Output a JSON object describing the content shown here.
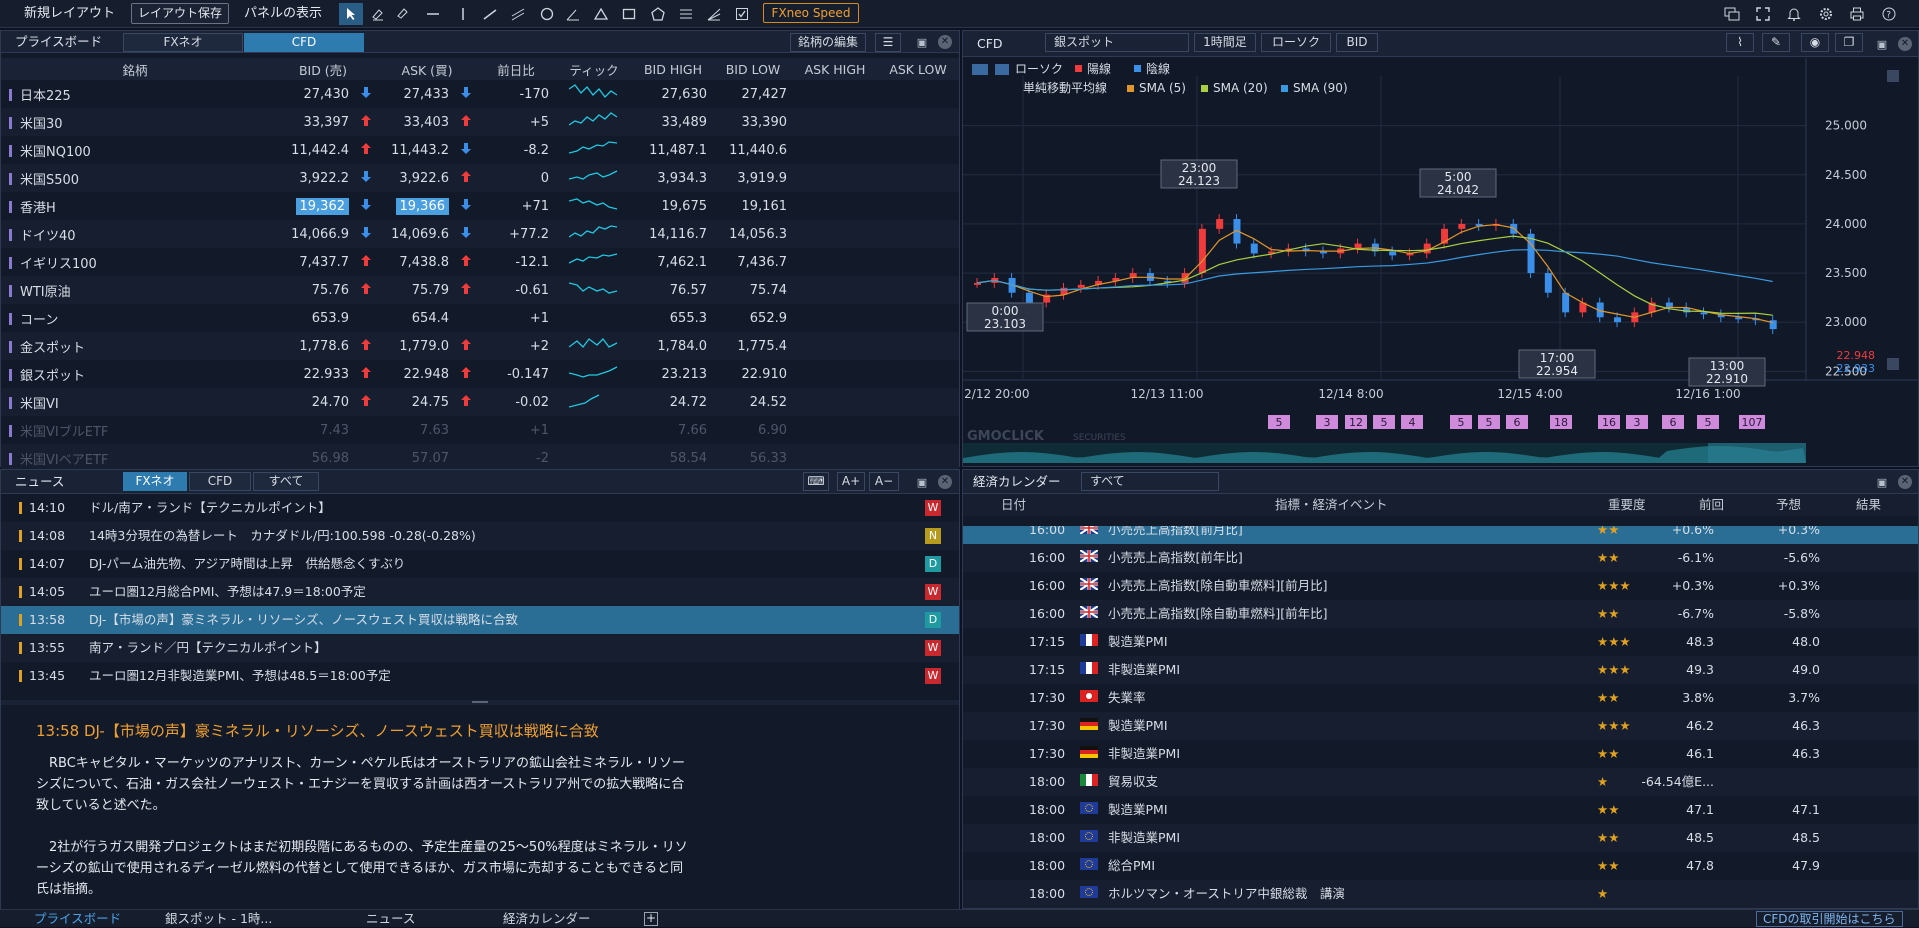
{
  "toolbar": {
    "new_layout": "新規レイアウト",
    "save_layout": "レイアウト保存",
    "panel_show": "パネルの表示",
    "speed": "FXneo Speed"
  },
  "priceboard": {
    "title": "プライスボード",
    "tabs": [
      "FXネオ",
      "CFD"
    ],
    "edit": "銘柄の編集",
    "headers": [
      "銘柄",
      "BID (売)",
      "ASK (買)",
      "前日比",
      "ティック",
      "BID HIGH",
      "BID LOW",
      "ASK HIGH",
      "ASK LOW"
    ],
    "rows": [
      {
        "name": "日本225",
        "bid": "27,430",
        "bdir": "dn",
        "ask": "27,433",
        "adir": "dn",
        "chg": "-170",
        "bh": "27,630",
        "bl": "27,427"
      },
      {
        "name": "米国30",
        "bid": "33,397",
        "bdir": "up",
        "ask": "33,403",
        "adir": "up",
        "chg": "+5",
        "bh": "33,489",
        "bl": "33,390"
      },
      {
        "name": "米国NQ100",
        "bid": "11,442.4",
        "bdir": "up",
        "ask": "11,443.2",
        "adir": "dn",
        "chg": "-8.2",
        "bh": "11,487.1",
        "bl": "11,440.6"
      },
      {
        "name": "米国S500",
        "bid": "3,922.2",
        "bdir": "dn",
        "ask": "3,922.6",
        "adir": "up",
        "chg": "0",
        "bh": "3,934.3",
        "bl": "3,919.9"
      },
      {
        "name": "香港H",
        "bid": "19,362",
        "bdir": "dn",
        "ask": "19,366",
        "adir": "dn",
        "chg": "+71",
        "bh": "19,675",
        "bl": "19,161",
        "hl": true
      },
      {
        "name": "ドイツ40",
        "bid": "14,066.9",
        "bdir": "dn",
        "ask": "14,069.6",
        "adir": "dn",
        "chg": "+77.2",
        "bh": "14,116.7",
        "bl": "14,056.3"
      },
      {
        "name": "イギリス100",
        "bid": "7,437.7",
        "bdir": "up",
        "ask": "7,438.8",
        "adir": "up",
        "chg": "-12.1",
        "bh": "7,462.1",
        "bl": "7,436.7"
      },
      {
        "name": "WTI原油",
        "bid": "75.76",
        "bdir": "up",
        "ask": "75.79",
        "adir": "up",
        "chg": "-0.61",
        "bh": "76.57",
        "bl": "75.74"
      },
      {
        "name": "コーン",
        "bid": "653.9",
        "bdir": "",
        "ask": "654.4",
        "adir": "",
        "chg": "+1",
        "bh": "655.3",
        "bl": "652.9"
      },
      {
        "name": "金スポット",
        "bid": "1,778.6",
        "bdir": "up",
        "ask": "1,779.0",
        "adir": "up",
        "chg": "+2",
        "bh": "1,784.0",
        "bl": "1,775.4"
      },
      {
        "name": "銀スポット",
        "bid": "22.933",
        "bdir": "up",
        "ask": "22.948",
        "adir": "up",
        "chg": "-0.147",
        "bh": "23.213",
        "bl": "22.910"
      },
      {
        "name": "米国VI",
        "bid": "24.70",
        "bdir": "up",
        "ask": "24.75",
        "adir": "up",
        "chg": "-0.02",
        "bh": "24.72",
        "bl": "24.52"
      },
      {
        "name": "米国VIブルETF",
        "bid": "7.43",
        "bdir": "",
        "ask": "7.63",
        "adir": "",
        "chg": "+1",
        "bh": "7.66",
        "bl": "6.90",
        "dim": true
      },
      {
        "name": "米国VIベアETF",
        "bid": "56.98",
        "bdir": "",
        "ask": "57.07",
        "adir": "",
        "chg": "-2",
        "bh": "58.54",
        "bl": "56.33",
        "dim": true
      }
    ]
  },
  "chart": {
    "title": "CFD",
    "symbol": "銀スポット",
    "timeframe": "1時間足",
    "ctype": "ローソク",
    "price_type": "BID",
    "legend": {
      "type": "ローソク",
      "up": "陽線",
      "down": "陰線",
      "ma": "単純移動平均線",
      "sma5": "SMA (5)",
      "sma20": "SMA (20)",
      "sma90": "SMA (90)"
    },
    "yticks": [
      "25.000",
      "24.500",
      "24.000",
      "23.500",
      "23.000",
      "22.500"
    ],
    "xticks": [
      "12/12 20:00",
      "12/13 11:00",
      "12/14 8:00",
      "12/15 4:00",
      "12/16 1:00"
    ],
    "callouts": [
      {
        "time": "0:00",
        "price": "23.103"
      },
      {
        "time": "23:00",
        "price": "24.123"
      },
      {
        "time": "5:00",
        "price": "24.042"
      },
      {
        "time": "17:00",
        "price": "22.954"
      },
      {
        "time": "13:00",
        "price": "22.910"
      }
    ],
    "price_ask": "22.948",
    "price_bid": "22.933",
    "events": [
      "5",
      "3",
      "12",
      "5",
      "4",
      "5",
      "5",
      "6",
      "18",
      "16",
      "3",
      "6",
      "5",
      "107"
    ],
    "watermark": "GMOCLICK",
    "watermark2": "SECURITIES",
    "chart_data": {
      "type": "line",
      "ylim": [
        22.3,
        25.2
      ],
      "candles": [
        23.4,
        23.45,
        23.3,
        23.2,
        23.28,
        23.35,
        23.38,
        23.42,
        23.45,
        23.5,
        23.42,
        23.4,
        23.5,
        23.95,
        24.05,
        23.8,
        23.7,
        23.72,
        23.75,
        23.72,
        23.7,
        23.75,
        23.8,
        23.72,
        23.68,
        23.7,
        23.8,
        23.95,
        24.0,
        23.98,
        24.0,
        23.9,
        23.5,
        23.3,
        23.1,
        23.2,
        23.05,
        23.0,
        23.1,
        23.2,
        23.15,
        23.1,
        23.08,
        23.05,
        23.04,
        23.02,
        22.93
      ]
    }
  },
  "news": {
    "title": "ニュース",
    "tabs": [
      "FXネオ",
      "CFD",
      "すべて"
    ],
    "aplus": "A+",
    "aminus": "A−",
    "items": [
      {
        "time": "14:10",
        "head": "ドル/南ア・ランド【テクニカルポイント】",
        "src": "W"
      },
      {
        "time": "14:08",
        "head": "14時3分現在の為替レート　カナダドル/円:100.598 -0.28(-0.28%)",
        "src": "N"
      },
      {
        "time": "14:07",
        "head": "DJ-パーム油先物、アジア時間は上昇　供給懸念くすぶり",
        "src": "D"
      },
      {
        "time": "14:05",
        "head": "ユーロ圏12月総合PMI、予想は47.9＝18:00予定",
        "src": "W"
      },
      {
        "time": "13:58",
        "head": "DJ-【市場の声】豪ミネラル・リソーシズ、ノースウェスト買収は戦略に合致",
        "src": "D",
        "sel": true
      },
      {
        "time": "13:55",
        "head": "南ア・ランド／円【テクニカルポイント】",
        "src": "W"
      },
      {
        "time": "13:45",
        "head": "ユーロ圏12月非製造業PMI、予想は48.5＝18:00予定",
        "src": "W"
      }
    ],
    "detail_title": "13:58  DJ-【市場の声】豪ミネラル・リソーシズ、ノースウェスト買収は戦略に合致",
    "p1a": "　RBCキャピタル・マーケッツのアナリスト、カーン・ペケル氏はオーストラリアの鉱山会社ミネラル・リソー",
    "p1b": "シズについて、石油・ガス会社ノーウェスト・エナジーを買収する計画は西オーストラリア州での拡大戦略に合",
    "p1c": "致していると述べた。",
    "p2a": "　2社が行うガス開発プロジェクトはまだ初期段階にあるものの、予定生産量の25～50%程度はミネラル・リソ",
    "p2b": "ーシズの鉱山で使用されるディーゼル燃料の代替として使用できるほか、ガス市場に売却することもできると同",
    "p2c": "氏は指摘。"
  },
  "calendar": {
    "title": "経済カレンダー",
    "filter": "すべて",
    "headers": [
      "日付",
      "指標・経済イベント",
      "重要度",
      "前回",
      "予想",
      "結果"
    ],
    "rows": [
      {
        "time": "16:00",
        "flag": "uk",
        "ev": "小売売上高指数[前月比]",
        "st": "★★",
        "prev": "+0.6%",
        "fc": "+0.3%",
        "sel": true
      },
      {
        "time": "16:00",
        "flag": "uk",
        "ev": "小売売上高指数[前年比]",
        "st": "★★",
        "prev": "-6.1%",
        "fc": "-5.6%"
      },
      {
        "time": "16:00",
        "flag": "uk",
        "ev": "小売売上高指数[除自動車燃料][前月比]",
        "st": "★★★",
        "prev": "+0.3%",
        "fc": "+0.3%"
      },
      {
        "time": "16:00",
        "flag": "uk",
        "ev": "小売売上高指数[除自動車燃料][前年比]",
        "st": "★★",
        "prev": "-6.7%",
        "fc": "-5.8%"
      },
      {
        "time": "17:15",
        "flag": "fr",
        "ev": "製造業PMI",
        "st": "★★★",
        "prev": "48.3",
        "fc": "48.0"
      },
      {
        "time": "17:15",
        "flag": "fr",
        "ev": "非製造業PMI",
        "st": "★★★",
        "prev": "49.3",
        "fc": "49.0"
      },
      {
        "time": "17:30",
        "flag": "hk",
        "ev": "失業率",
        "st": "★★",
        "prev": "3.8%",
        "fc": "3.7%"
      },
      {
        "time": "17:30",
        "flag": "de",
        "ev": "製造業PMI",
        "st": "★★★",
        "prev": "46.2",
        "fc": "46.3"
      },
      {
        "time": "17:30",
        "flag": "de",
        "ev": "非製造業PMI",
        "st": "★★",
        "prev": "46.1",
        "fc": "46.3"
      },
      {
        "time": "18:00",
        "flag": "it",
        "ev": "貿易収支",
        "st": "★",
        "prev": "-64.54億E...",
        "fc": ""
      },
      {
        "time": "18:00",
        "flag": "eu",
        "ev": "製造業PMI",
        "st": "★★",
        "prev": "47.1",
        "fc": "47.1"
      },
      {
        "time": "18:00",
        "flag": "eu",
        "ev": "非製造業PMI",
        "st": "★★",
        "prev": "48.5",
        "fc": "48.5"
      },
      {
        "time": "18:00",
        "flag": "eu",
        "ev": "総合PMI",
        "st": "★★",
        "prev": "47.8",
        "fc": "47.9"
      },
      {
        "time": "18:00",
        "flag": "eu",
        "ev": "ホルツマン・オーストリア中銀総裁　講演",
        "st": "★",
        "prev": "",
        "fc": ""
      }
    ]
  },
  "bottom": {
    "tabs": [
      "プライスボード",
      "銀スポット - 1時...",
      "ニュース",
      "経済カレンダー"
    ],
    "cfd_link": "CFDの取引開始はこちら"
  }
}
